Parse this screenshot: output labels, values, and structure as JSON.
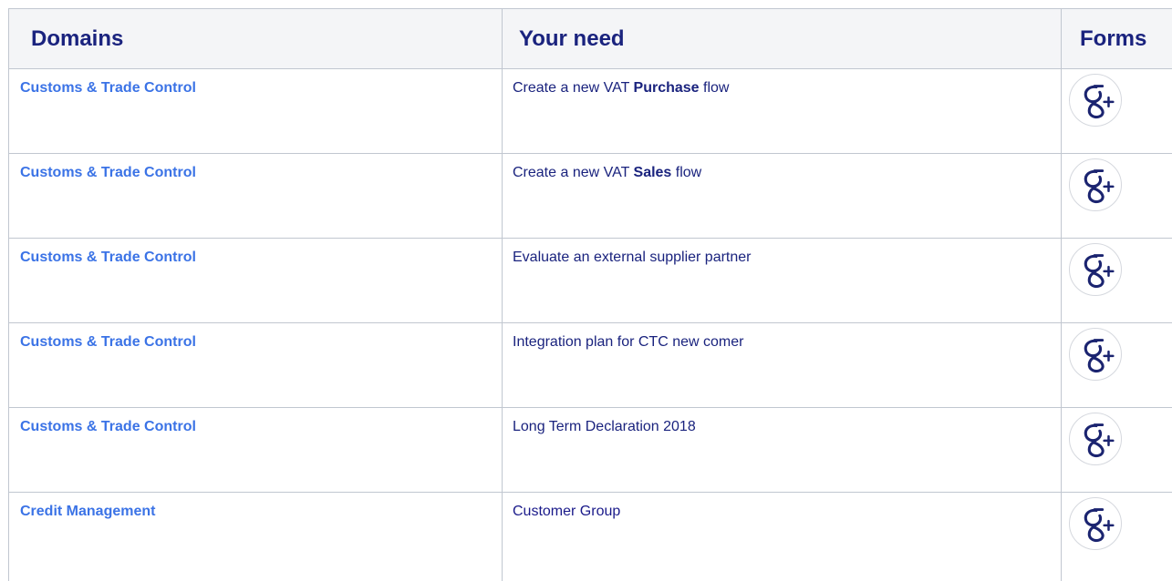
{
  "headers": {
    "domains": "Domains",
    "need": "Your need",
    "forms": "Forms"
  },
  "rows": [
    {
      "domain": "Customs & Trade Control",
      "need_pre": "Create a new VAT ",
      "need_bold": "Purchase",
      "need_post": " flow",
      "form_icon": "google-plus-icon"
    },
    {
      "domain": "Customs & Trade Control",
      "need_pre": "Create a new VAT ",
      "need_bold": "Sales",
      "need_post": " flow",
      "form_icon": "google-plus-icon"
    },
    {
      "domain": "Customs & Trade Control",
      "need_pre": "Evaluate an external supplier partner",
      "need_bold": "",
      "need_post": "",
      "form_icon": "google-plus-icon"
    },
    {
      "domain": "Customs & Trade Control",
      "need_pre": "Integration plan for CTC new comer",
      "need_bold": "",
      "need_post": "",
      "form_icon": "google-plus-icon"
    },
    {
      "domain": "Customs & Trade Control",
      "need_pre": "Long Term Declaration 2018",
      "need_bold": "",
      "need_post": "",
      "form_icon": "google-plus-icon"
    },
    {
      "domain": "Credit Management",
      "need_pre": "Customer Group",
      "need_bold": "",
      "need_post": "",
      "form_icon": "google-plus-icon"
    }
  ],
  "colors": {
    "header_text": "#1a237e",
    "link": "#3b73e6",
    "header_bg": "#f4f5f7",
    "border": "#c1c7d0"
  }
}
